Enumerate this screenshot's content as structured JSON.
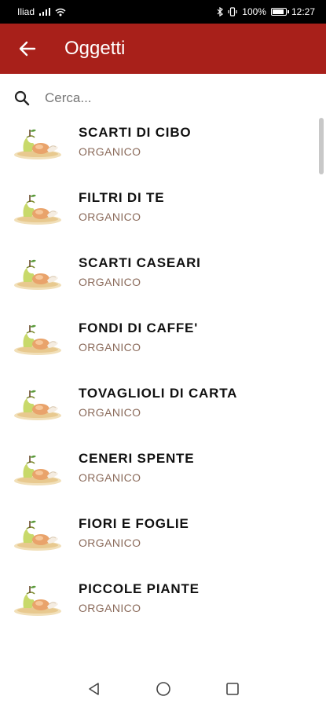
{
  "status": {
    "network": "Iliad",
    "battery": "100%",
    "battery_level": 1.0,
    "time": "12:27"
  },
  "header": {
    "title": "Oggetti"
  },
  "search": {
    "placeholder": "Cerca..."
  },
  "items": [
    {
      "title": "SCARTI DI CIBO",
      "category": "ORGANICO"
    },
    {
      "title": "FILTRI DI TE",
      "category": "ORGANICO"
    },
    {
      "title": "SCARTI CASEARI",
      "category": "ORGANICO"
    },
    {
      "title": "FONDI DI CAFFE'",
      "category": "ORGANICO"
    },
    {
      "title": "TOVAGLIOLI DI CARTA",
      "category": "ORGANICO"
    },
    {
      "title": "CENERI SPENTE",
      "category": "ORGANICO"
    },
    {
      "title": "FIORI E FOGLIE",
      "category": "ORGANICO"
    },
    {
      "title": "PICCOLE PIANTE",
      "category": "ORGANICO"
    }
  ],
  "colors": {
    "appbar": "#a8201a",
    "category_text": "#8a6a5a"
  }
}
